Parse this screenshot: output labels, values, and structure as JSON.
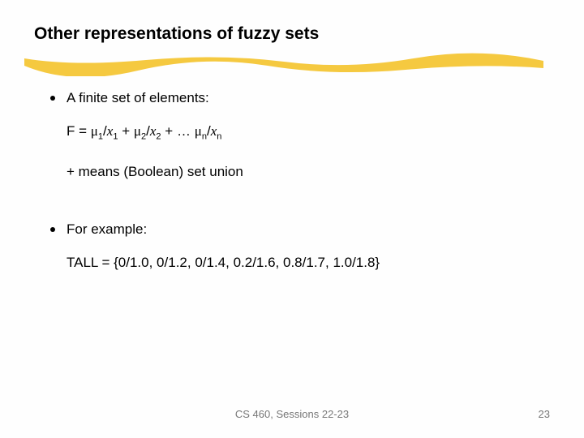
{
  "title": "Other representations of fuzzy sets",
  "bullets": {
    "finite": "A finite set of elements:",
    "example": "For example:"
  },
  "formula": {
    "lhs": "F = ",
    "mu": "μ",
    "x": "x",
    "slash": "/",
    "plus": " + ",
    "dots": " + … ",
    "idx1": "1",
    "idx2": "2",
    "idxn": "n"
  },
  "note": "+ means (Boolean) set union",
  "tall": {
    "label": "TALL = ",
    "set": "{0/1.0, 0/1.2, 0/1.4, 0.2/1.6, 0.8/1.7, 1.0/1.8}"
  },
  "footer": {
    "center": "CS 460,  Sessions 22-23",
    "page": "23"
  }
}
